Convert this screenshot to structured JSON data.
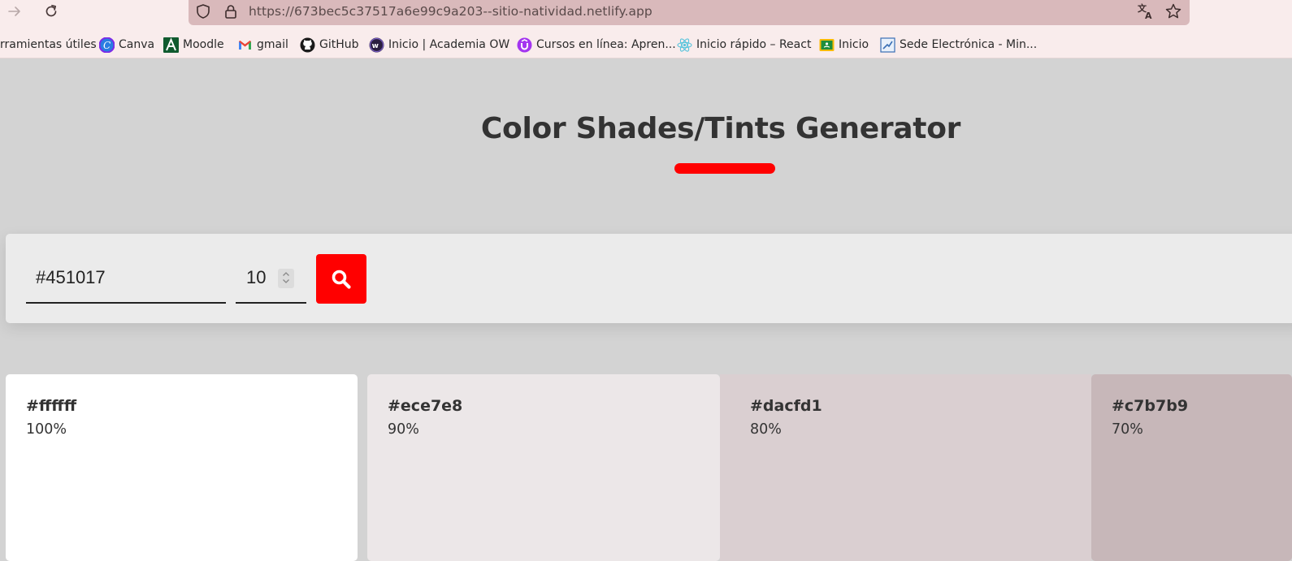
{
  "browser": {
    "url": "https://673bec5c37517a6e99c9a203--sitio-natividad.netlify.app",
    "bookmarks": [
      {
        "label": "rramientas útiles",
        "icon": "none"
      },
      {
        "label": "Canva",
        "icon": "canva-icon"
      },
      {
        "label": "Moodle",
        "icon": "moodle-icon"
      },
      {
        "label": "gmail",
        "icon": "gmail-icon"
      },
      {
        "label": "GitHub",
        "icon": "github-icon"
      },
      {
        "label": "Inicio | Academia OW",
        "icon": "academia-ow-icon"
      },
      {
        "label": "Cursos en línea: Apren...",
        "icon": "udemy-icon"
      },
      {
        "label": "Inicio rápido – React",
        "icon": "react-icon"
      },
      {
        "label": "Inicio",
        "icon": "classroom-icon"
      },
      {
        "label": "Sede Electrónica - Min...",
        "icon": "sede-icon"
      }
    ]
  },
  "page": {
    "title": "Color Shades/Tints Generator",
    "accent": "#ff0000",
    "color_input": "#451017",
    "count_input": "10"
  },
  "swatches": [
    {
      "hex": "#ffffff",
      "percent": "100%",
      "bg": "#ffffff"
    },
    {
      "hex": "#ece7e8",
      "percent": "90%",
      "bg": "#ece7e8"
    },
    {
      "hex": "#dacfd1",
      "percent": "80%",
      "bg": "#dacfd1"
    },
    {
      "hex": "#c7b7b9",
      "percent": "70%",
      "bg": "#c7b7b9"
    }
  ]
}
